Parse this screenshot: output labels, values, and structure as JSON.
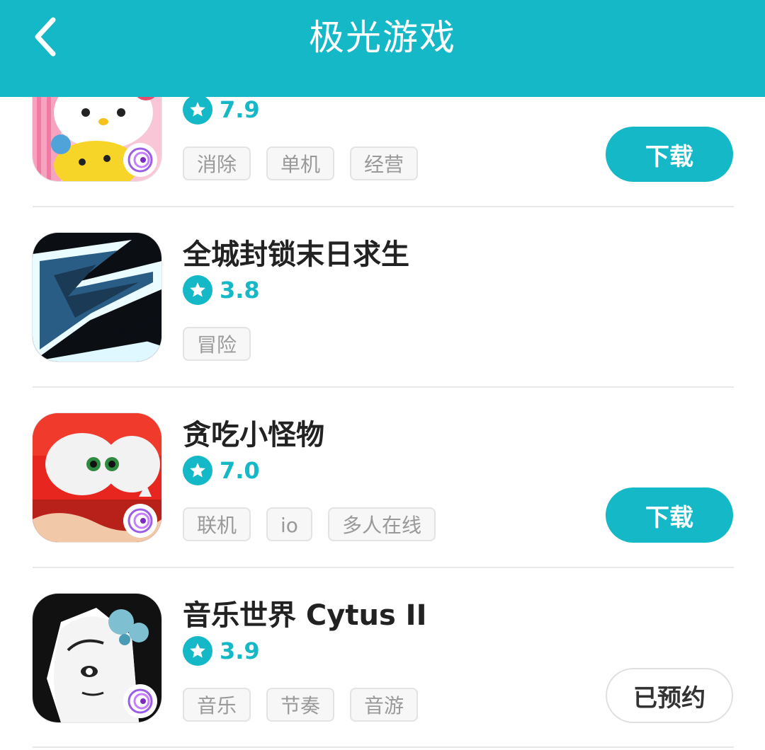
{
  "header": {
    "title": "极光游戏",
    "back_icon": "chevron-left-icon",
    "background": "#15b8c6"
  },
  "games": [
    {
      "name": "",
      "rating": "7.9",
      "tags": [
        "消除",
        "单机",
        "经营"
      ],
      "action": "下载"
    },
    {
      "name": "全城封锁末日求生",
      "rating": "3.8",
      "tags": [
        "冒险"
      ],
      "action": ""
    },
    {
      "name": "贪吃小怪物",
      "rating": "7.0",
      "tags": [
        "联机",
        "io",
        "多人在线"
      ],
      "action": "下载"
    },
    {
      "name": "音乐世界 Cytus II",
      "rating": "3.9",
      "tags": [
        "音乐",
        "节奏",
        "音游"
      ],
      "action": "已预约"
    }
  ],
  "colors": {
    "accent": "#15b8c6",
    "title_text": "#222222",
    "tag_text": "#999999"
  }
}
